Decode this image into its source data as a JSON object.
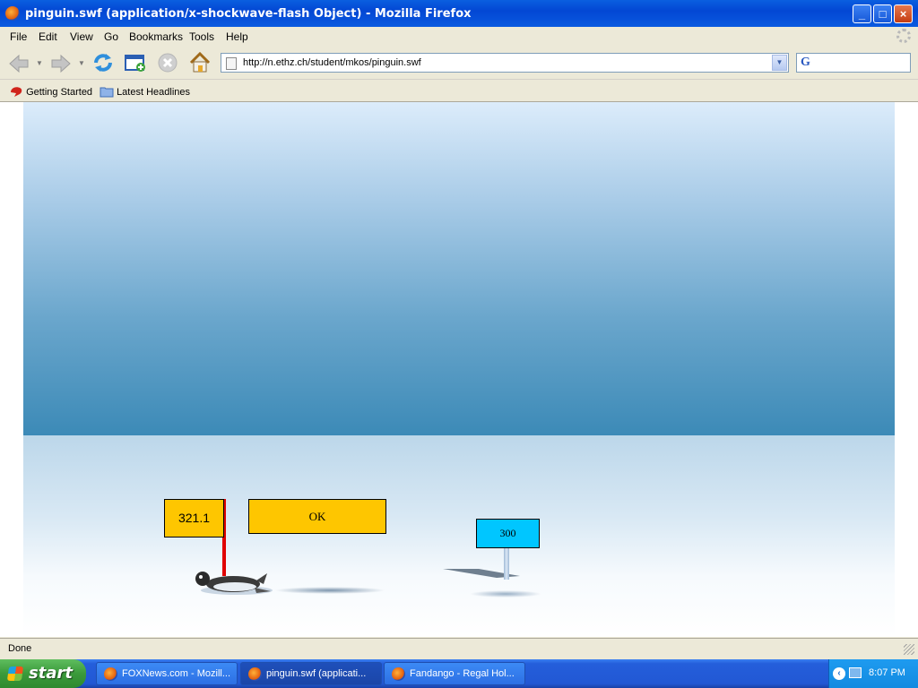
{
  "window": {
    "title": "pinguin.swf (application/x-shockwave-flash Object) - Mozilla Firefox",
    "minimize_glyph": "_",
    "maximize_glyph": "□",
    "close_glyph": "×"
  },
  "menu": {
    "items": [
      "File",
      "Edit",
      "View",
      "Go",
      "Bookmarks",
      "Tools",
      "Help"
    ]
  },
  "navigation": {
    "url": "http://n.ethz.ch/student/mkos/pinguin.swf",
    "dropdown_glyph": "▼",
    "search_engine_glyph": "G"
  },
  "bookmarks": {
    "items": [
      "Getting Started",
      "Latest Headlines"
    ]
  },
  "game": {
    "distance": "321.1",
    "ok_label": "OK",
    "marker_label": "300",
    "colors": {
      "distance_sign": "#fec600",
      "ok_button": "#fec600",
      "marker_sign": "#00c6ff",
      "pole": "#e00000"
    }
  },
  "status": {
    "text": "Done"
  },
  "taskbar": {
    "start_label": "start",
    "tasks": [
      "FOXNews.com - Mozill...",
      "pinguin.swf (applicati...",
      "Fandango - Regal Hol..."
    ],
    "clock": "8:07 PM",
    "tray_chevron": "‹"
  }
}
